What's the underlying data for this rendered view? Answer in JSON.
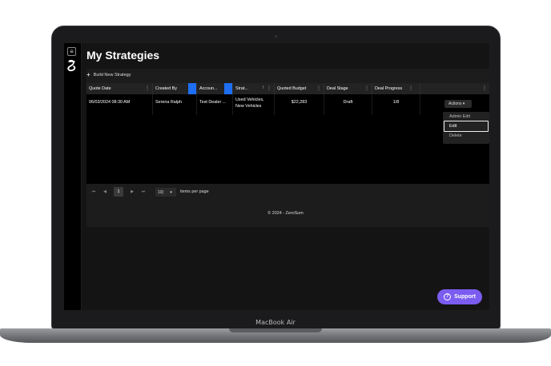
{
  "device": {
    "label": "MacBook Air"
  },
  "app": {
    "menu_icon": "hamburger-icon",
    "logo_icon": "zerosum-logo-icon",
    "page_title": "My Strategies",
    "build_button": {
      "icon": "plus-icon",
      "label": "Build New Strategy"
    }
  },
  "table": {
    "columns": [
      {
        "label": "Quote Date"
      },
      {
        "label": "Created By"
      },
      {
        "label": "Accoun..."
      },
      {
        "label": "Strat...",
        "sort": "↑"
      },
      {
        "label": "Quoted Budget"
      },
      {
        "label": "Deal Stage"
      },
      {
        "label": "Deal Progress"
      },
      {
        "label": ""
      }
    ],
    "rows": [
      {
        "quote_date": "06/03/2024 08:30 AM",
        "created_by": "Serena Ralph",
        "account": "Test Dealer ...",
        "strategy_line1": "Used Vehicles,",
        "strategy_line2": "New Vehicles",
        "quoted_budget": "$22,283",
        "deal_stage": "Draft",
        "deal_progress": "1/8",
        "actions_label": "Actions"
      }
    ]
  },
  "actions_menu": {
    "items": [
      "Admin Edit",
      "Edit",
      "Delete"
    ],
    "highlighted": "Edit"
  },
  "pagination": {
    "first": "⏮",
    "prev": "◀",
    "current_page": "1",
    "next": "▶",
    "last": "⏭",
    "per_page_value": "10(",
    "per_page_label": "items per page"
  },
  "footer": {
    "text": "© 2024 - ZeroSum"
  },
  "support_button": {
    "label": "Support",
    "icon": "question-icon",
    "color": "#7b5cf0"
  }
}
